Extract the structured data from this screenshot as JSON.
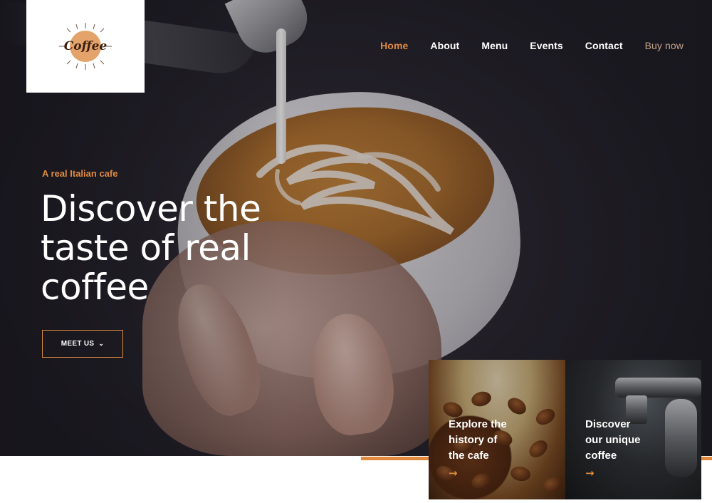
{
  "logo": {
    "text": "Coffee"
  },
  "nav": {
    "items": [
      {
        "label": "Home",
        "active": true
      },
      {
        "label": "About",
        "active": false
      },
      {
        "label": "Menu",
        "active": false
      },
      {
        "label": "Events",
        "active": false
      },
      {
        "label": "Contact",
        "active": false
      }
    ],
    "buy_label": "Buy now"
  },
  "hero": {
    "eyebrow": "A real Italian cafe",
    "headline_line1": "Discover the",
    "headline_line2": "taste of real",
    "headline_line3": "coffee",
    "cta_label": "MEET US",
    "cta_icon": "chevron-down-icon"
  },
  "cards": [
    {
      "line1": "Explore the",
      "line2": "history of",
      "line3": "the cafe",
      "icon": "arrow-right-icon"
    },
    {
      "line1": "Discover",
      "line2": "our unique",
      "line3": "coffee",
      "icon": "arrow-right-icon"
    }
  ],
  "colors": {
    "accent": "#e08a3e",
    "buy_now": "#c0a28a",
    "text_light": "#ffffff",
    "hero_dark": "#25222b"
  }
}
